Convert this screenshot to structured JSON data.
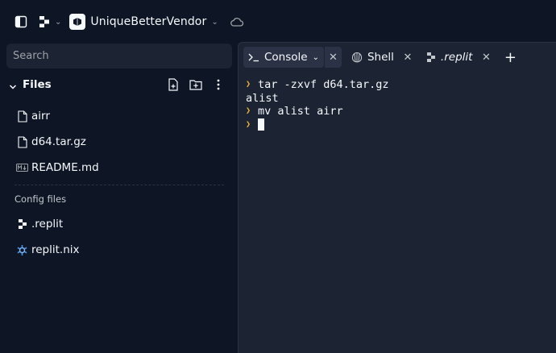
{
  "topbar": {
    "repl_name": "UniqueBetterVendor"
  },
  "sidebar": {
    "search_placeholder": "Search",
    "files_title": "Files",
    "files": [
      {
        "name": "airr",
        "icon": "file-icon"
      },
      {
        "name": "d64.tar.gz",
        "icon": "file-icon"
      },
      {
        "name": "README.md",
        "icon": "markdown-icon"
      }
    ],
    "config_label": "Config files",
    "config_files": [
      {
        "name": ".replit",
        "icon": "replit-config-icon"
      },
      {
        "name": "replit.nix",
        "icon": "nix-icon"
      }
    ]
  },
  "tabs": [
    {
      "label": "Console",
      "icon": "terminal-prompt-icon",
      "active": true
    },
    {
      "label": "Shell",
      "icon": "shell-icon",
      "active": false
    },
    {
      "label": ".replit",
      "icon": "replit-config-icon",
      "active": false
    }
  ],
  "console": {
    "lines": [
      {
        "prompt": true,
        "text": "tar -zxvf d64.tar.gz"
      },
      {
        "prompt": false,
        "text": "alist"
      },
      {
        "prompt": true,
        "text": "mv alist airr"
      },
      {
        "prompt": true,
        "text": ""
      }
    ]
  },
  "colors": {
    "background": "#0e1525",
    "panel": "#1c2333",
    "accent_prompt": "#f0b43c",
    "nix_blue": "#4a90e2"
  }
}
